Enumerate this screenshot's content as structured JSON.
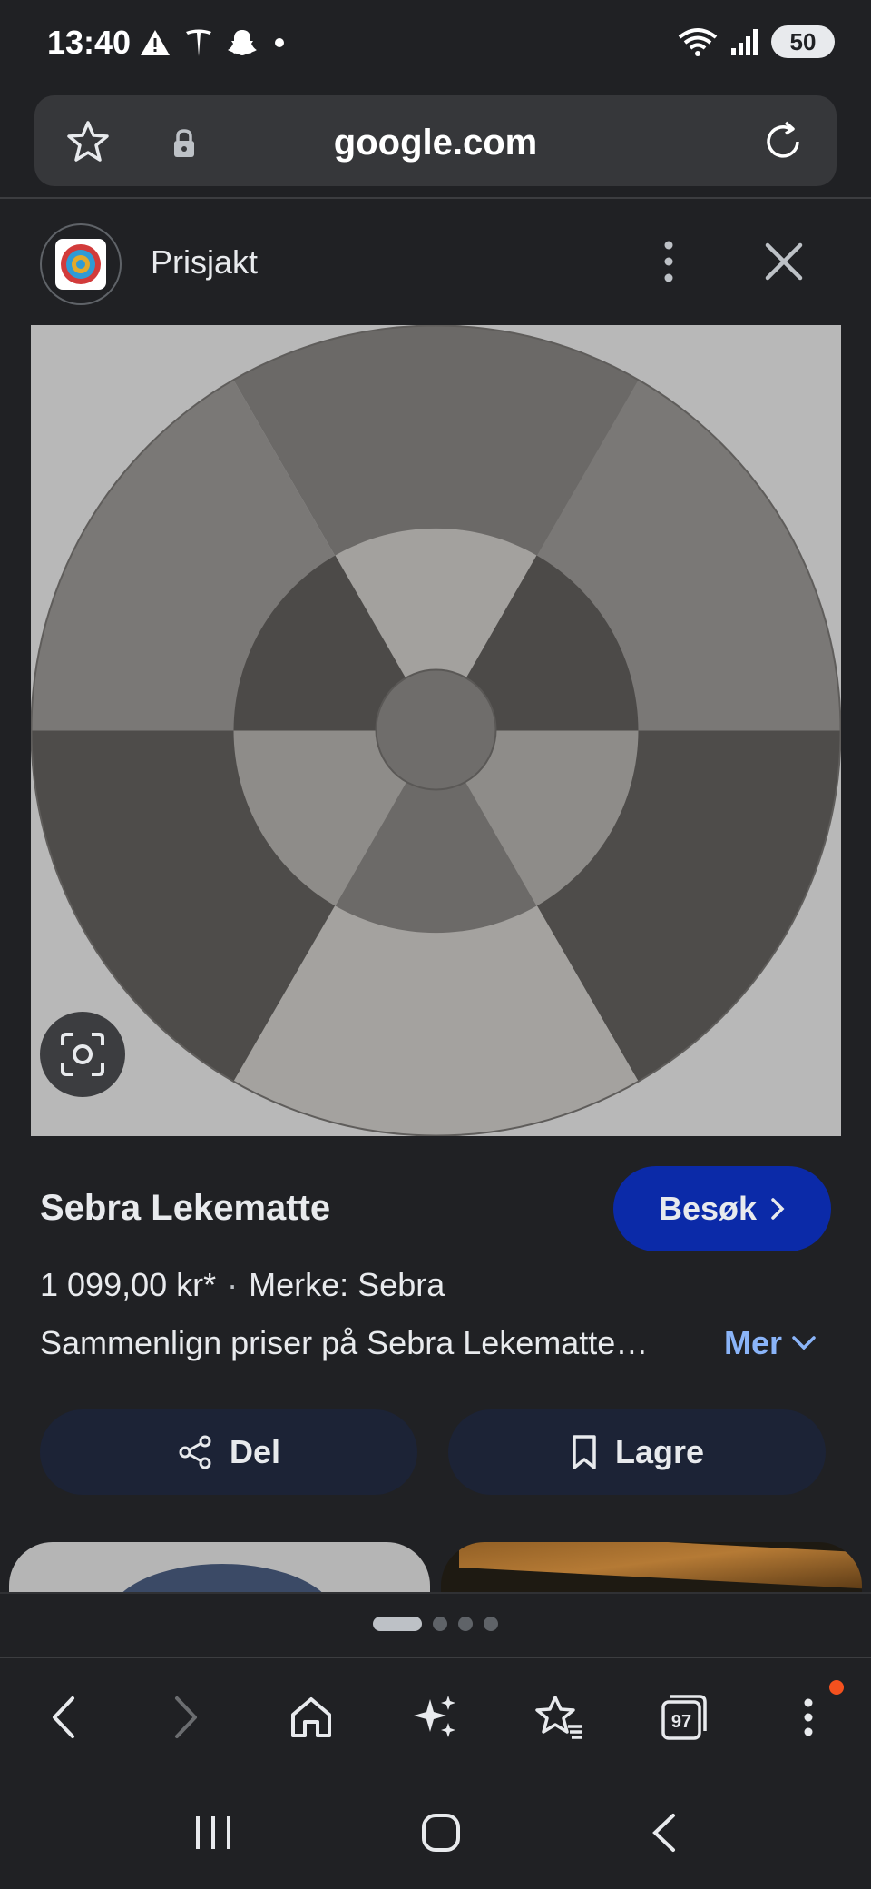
{
  "status_bar": {
    "time": "13:40",
    "battery": "50",
    "left_icons": [
      "warning-icon",
      "tesla-icon",
      "snapchat-icon",
      "dot-icon"
    ],
    "right_icons": [
      "wifi-icon",
      "signal-icon",
      "battery-icon"
    ]
  },
  "browser": {
    "url": "google.com"
  },
  "result": {
    "source_name": "Prisjakt",
    "product_title": "Sebra Lekematte",
    "visit_label": "Besøk",
    "price": "1 099,00 kr*",
    "separator": "·",
    "brand": "Merke: Sebra",
    "description": "Sammenlign priser på Sebra Lekematte…",
    "more_label": "Mer",
    "share_label": "Del",
    "save_label": "Lagre"
  },
  "pager": {
    "pages": 4,
    "active_index": 0
  },
  "toolbar": {
    "items": [
      "back-icon",
      "forward-icon",
      "home-icon",
      "sparkle-icon",
      "bookmark-star-icon",
      "tabs-icon",
      "more-icon"
    ],
    "tab_count": "97"
  },
  "colors": {
    "background": "#202124",
    "accent_button": "#0b2aa8",
    "link": "#8ab4f8",
    "pill_button": "#1c2336"
  }
}
